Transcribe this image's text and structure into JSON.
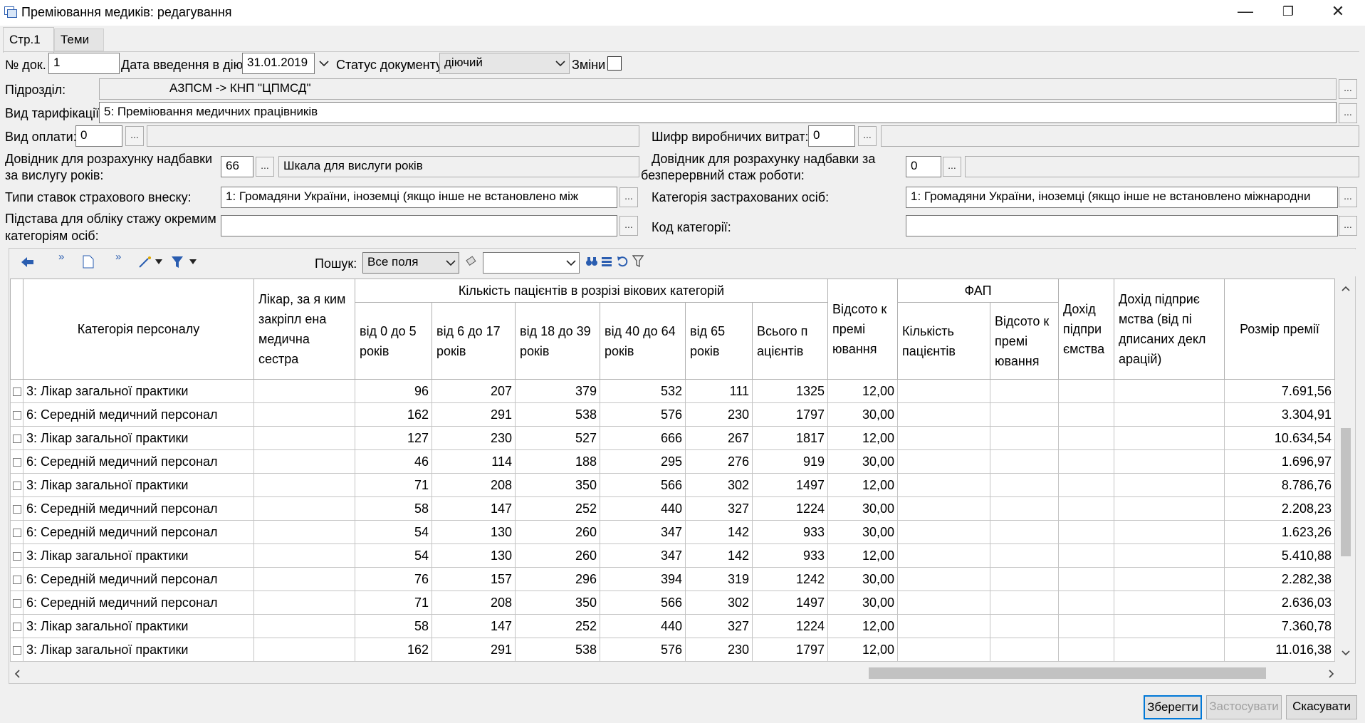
{
  "window": {
    "title": "Преміювання медиків: редагування",
    "minimize": "—",
    "maximize": "❐",
    "close": "✕"
  },
  "tabs": [
    {
      "label": "Стр.1"
    },
    {
      "label": "Теми"
    }
  ],
  "form": {
    "doc_no_label": "№ док.",
    "doc_no": "1",
    "date_label": "Дата введення в дію",
    "date": "31.01.2019",
    "status_label": "Статус документу",
    "status": "діючий",
    "changes_label": "Зміни",
    "unit_label": "Підрозділ:",
    "unit": "АЗПСМ -> КНП \"ЦПМСД\"",
    "tariff_label": "Вид тарифікації:",
    "tariff": "5: Преміювання медичних працівників",
    "pay_label": "Вид оплати:",
    "pay_code": "0",
    "cost_label": "Шифр виробничих витрат:",
    "cost_code": "0",
    "seniority_ref_label_1": "Довідник для розрахунку надбавки",
    "seniority_ref_label_2": "за вислугу років:",
    "seniority_ref_code": "66",
    "seniority_ref_name": "Шкала для вислуги років",
    "cont_ref_label_1": "Довідник для розрахунку надбавки за",
    "cont_ref_label_2": "безперервний стаж роботи:",
    "cont_ref_code": "0",
    "insurance_label": "Типи ставок страхового внеску:",
    "insurance_value": "1: Громадяни України,  іноземці  (якщо  інше  не  встановлено між",
    "insured_cat_label": "Категорія застрахованих осіб:",
    "insured_cat_value": "1: Громадяни України, іноземці (якщо інше не встановлено міжнародни",
    "basis_label_1": "Підстава для обліку стажу окремим",
    "basis_label_2": "категоріям осіб:",
    "basis_value": "",
    "category_code_label": "Код категорії:",
    "category_code_value": "",
    "dots": "..."
  },
  "toolbar": {
    "search_label": "Пошук:",
    "search_field": "Все поля",
    "search_value": ""
  },
  "grid": {
    "headers": {
      "category": "Категорія персоналу",
      "doctor": "Лікар, за я ким закріпл ена медична сестра",
      "age_group": "Кількість пацієнтів в розрізі вікових категорій",
      "age_0_5": "від 0 до 5 років",
      "age_6_17": "від 6 до 17 років",
      "age_18_39": "від 18 до 39 років",
      "age_40_64": "від 40 до 64 років",
      "age_65": "від 65 років",
      "total": "Всього п ацієнтів",
      "percent": "Відсото к премі ювання",
      "fap": "ФАП",
      "fap_patients": "Кількість пацієнтів",
      "fap_percent": "Відсото к премі ювання",
      "income": "Дохід підпри ємства",
      "income_declared": "Дохід підприє мства (від пі дписаних декл арацій)",
      "bonus": "Розмір премії"
    },
    "rows": [
      {
        "category": "3: Лікар загальної практики",
        "doctor": "",
        "a": "96",
        "b": "207",
        "c": "379",
        "d": "532",
        "e": "111",
        "total": "1325",
        "percent": "12,00",
        "fp": "",
        "fpc": "",
        "inc": "",
        "incd": "",
        "bonus": "7.691,56"
      },
      {
        "category": "6: Середній медичний персонал",
        "doctor": "",
        "a": "162",
        "b": "291",
        "c": "538",
        "d": "576",
        "e": "230",
        "total": "1797",
        "percent": "30,00",
        "fp": "",
        "fpc": "",
        "inc": "",
        "incd": "",
        "bonus": "3.304,91"
      },
      {
        "category": "3: Лікар загальної практики",
        "doctor": "",
        "a": "127",
        "b": "230",
        "c": "527",
        "d": "666",
        "e": "267",
        "total": "1817",
        "percent": "12,00",
        "fp": "",
        "fpc": "",
        "inc": "",
        "incd": "",
        "bonus": "10.634,54"
      },
      {
        "category": "6: Середній медичний персонал",
        "doctor": "",
        "a": "46",
        "b": "114",
        "c": "188",
        "d": "295",
        "e": "276",
        "total": "919",
        "percent": "30,00",
        "fp": "",
        "fpc": "",
        "inc": "",
        "incd": "",
        "bonus": "1.696,97"
      },
      {
        "category": "3: Лікар загальної практики",
        "doctor": "",
        "a": "71",
        "b": "208",
        "c": "350",
        "d": "566",
        "e": "302",
        "total": "1497",
        "percent": "12,00",
        "fp": "",
        "fpc": "",
        "inc": "",
        "incd": "",
        "bonus": "8.786,76"
      },
      {
        "category": "6: Середній медичний персонал",
        "doctor": "",
        "a": "58",
        "b": "147",
        "c": "252",
        "d": "440",
        "e": "327",
        "total": "1224",
        "percent": "30,00",
        "fp": "",
        "fpc": "",
        "inc": "",
        "incd": "",
        "bonus": "2.208,23"
      },
      {
        "category": "6: Середній медичний персонал",
        "doctor": "",
        "a": "54",
        "b": "130",
        "c": "260",
        "d": "347",
        "e": "142",
        "total": "933",
        "percent": "30,00",
        "fp": "",
        "fpc": "",
        "inc": "",
        "incd": "",
        "bonus": "1.623,26"
      },
      {
        "category": "3: Лікар загальної практики",
        "doctor": "",
        "a": "54",
        "b": "130",
        "c": "260",
        "d": "347",
        "e": "142",
        "total": "933",
        "percent": "12,00",
        "fp": "",
        "fpc": "",
        "inc": "",
        "incd": "",
        "bonus": "5.410,88"
      },
      {
        "category": "6: Середній медичний персонал",
        "doctor": "",
        "a": "76",
        "b": "157",
        "c": "296",
        "d": "394",
        "e": "319",
        "total": "1242",
        "percent": "30,00",
        "fp": "",
        "fpc": "",
        "inc": "",
        "incd": "",
        "bonus": "2.282,38"
      },
      {
        "category": "6: Середній медичний персонал",
        "doctor": "",
        "a": "71",
        "b": "208",
        "c": "350",
        "d": "566",
        "e": "302",
        "total": "1497",
        "percent": "30,00",
        "fp": "",
        "fpc": "",
        "inc": "",
        "incd": "",
        "bonus": "2.636,03"
      },
      {
        "category": "3: Лікар загальної практики",
        "doctor": "",
        "a": "58",
        "b": "147",
        "c": "252",
        "d": "440",
        "e": "327",
        "total": "1224",
        "percent": "12,00",
        "fp": "",
        "fpc": "",
        "inc": "",
        "incd": "",
        "bonus": "7.360,78"
      },
      {
        "category": "3: Лікар загальної практики",
        "doctor": "",
        "a": "162",
        "b": "291",
        "c": "538",
        "d": "576",
        "e": "230",
        "total": "1797",
        "percent": "12,00",
        "fp": "",
        "fpc": "",
        "inc": "",
        "incd": "",
        "bonus": "11.016,38"
      }
    ]
  },
  "buttons": {
    "save": "Зберегти",
    "apply": "Застосувати",
    "cancel": "Скасувати"
  }
}
